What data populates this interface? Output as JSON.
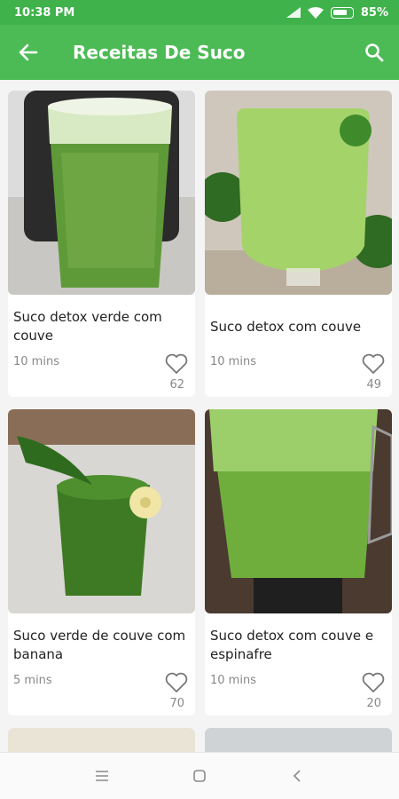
{
  "status_bar": {
    "time": "10:38 PM",
    "battery": "85%"
  },
  "app_bar": {
    "title": "Receitas De Suco"
  },
  "recipes": [
    {
      "title": "Suco detox verde com couve",
      "time": "10 mins",
      "likes": "62"
    },
    {
      "title": "Suco detox com couve",
      "time": "10 mins",
      "likes": "49"
    },
    {
      "title": "Suco verde de couve com banana",
      "time": "5 mins",
      "likes": "70"
    },
    {
      "title": "Suco detox com couve e espinafre",
      "time": "10 mins",
      "likes": "20"
    }
  ],
  "colors": {
    "status_bar": "#3fb24b",
    "app_bar": "#4cbb55",
    "juice_green": "#6aa93a",
    "text_muted": "#888888"
  },
  "icons": {
    "back": "arrow-left-icon",
    "search": "search-icon",
    "like": "heart-outline-icon",
    "nav_menu": "menu-icon",
    "nav_home": "square-icon",
    "nav_back": "chevron-left-icon"
  }
}
